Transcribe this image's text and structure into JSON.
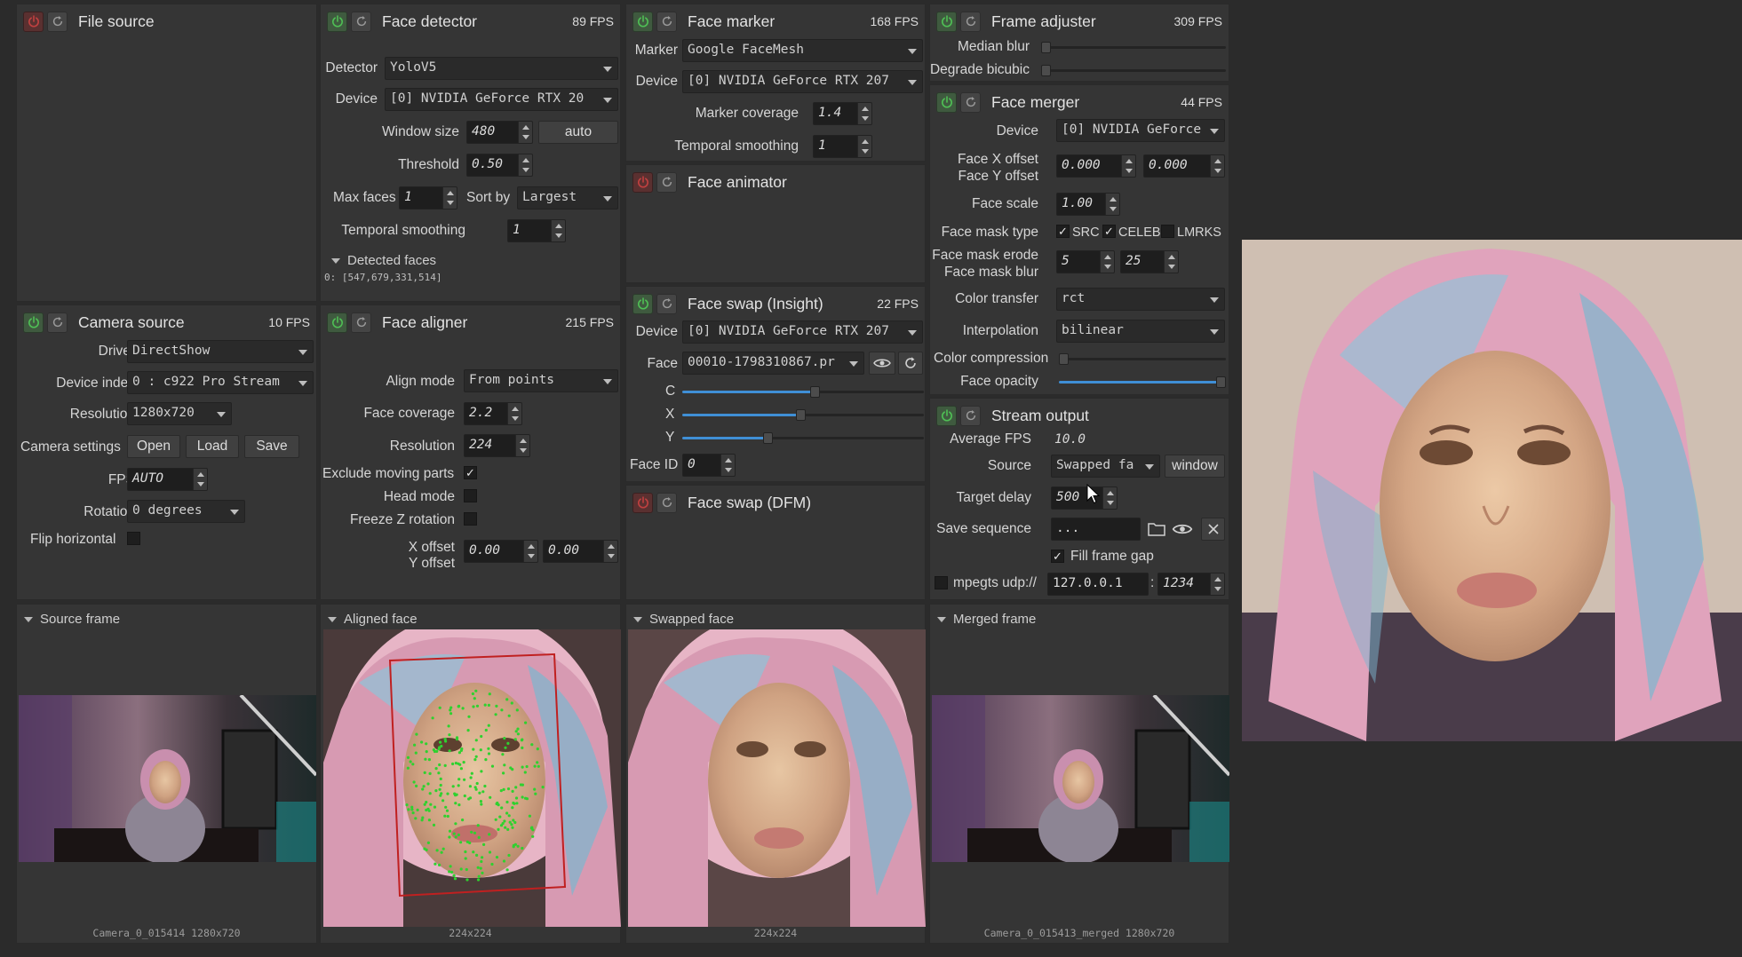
{
  "file_source": {
    "title": "File source"
  },
  "camera_source": {
    "title": "Camera source",
    "fps": "10 FPS",
    "driver_label": "Driver",
    "driver": "DirectShow",
    "device_index_label": "Device index",
    "device_index": "0 : c922 Pro Stream",
    "resolution_label": "Resolution",
    "resolution": "1280x720",
    "camera_settings_label": "Camera settings",
    "open": "Open",
    "load": "Load",
    "save": "Save",
    "fps_label": "FPS",
    "fps_value": "AUTO",
    "rotation_label": "Rotation",
    "rotation": "0 degrees",
    "flip_label": "Flip horizontal",
    "flip_checked": false
  },
  "face_detector": {
    "title": "Face detector",
    "fps": "89 FPS",
    "detector_label": "Detector",
    "detector": "YoloV5",
    "device_label": "Device",
    "device": "[0] NVIDIA GeForce RTX 20",
    "window_size_label": "Window size",
    "window_size": "480",
    "auto": "auto",
    "threshold_label": "Threshold",
    "threshold": "0.50",
    "max_faces_label": "Max faces",
    "max_faces": "1",
    "sort_by_label": "Sort by",
    "sort_by": "Largest",
    "temporal_label": "Temporal smoothing",
    "temporal": "1",
    "detected_label": "Detected faces",
    "detected_value": "0: [547,679,331,514]"
  },
  "face_aligner": {
    "title": "Face aligner",
    "fps": "215 FPS",
    "align_mode_label": "Align mode",
    "align_mode": "From points",
    "coverage_label": "Face coverage",
    "coverage": "2.2",
    "resolution_label": "Resolution",
    "resolution": "224",
    "exclude_label": "Exclude moving parts",
    "exclude_checked": true,
    "head_label": "Head mode",
    "freeze_label": "Freeze Z rotation",
    "x_offset_label": "X offset",
    "y_offset_label": "Y offset",
    "x_offset": "0.00",
    "y_offset": "0.00"
  },
  "face_marker": {
    "title": "Face marker",
    "fps": "168 FPS",
    "marker_label": "Marker",
    "marker": "Google FaceMesh",
    "device_label": "Device",
    "device": "[0] NVIDIA GeForce RTX 207",
    "coverage_label": "Marker coverage",
    "coverage": "1.4",
    "temporal_label": "Temporal smoothing",
    "temporal": "1"
  },
  "face_animator": {
    "title": "Face animator"
  },
  "face_swap_insight": {
    "title": "Face swap (Insight)",
    "fps": "22 FPS",
    "device_label": "Device",
    "device": "[0] NVIDIA GeForce RTX 207",
    "face_label": "Face",
    "face": "00010-1798310867.pr",
    "c_label": "C",
    "x_label": "X",
    "y_label": "Y",
    "c_value": 0.55,
    "x_value": 0.49,
    "y_value": 0.35,
    "face_id_label": "Face ID",
    "face_id": "0"
  },
  "face_swap_dfm": {
    "title": "Face swap (DFM)"
  },
  "frame_adjuster": {
    "title": "Frame adjuster",
    "fps": "309 FPS",
    "median_label": "Median blur",
    "degrade_label": "Degrade bicubic",
    "median_value": 0,
    "degrade_value": 0
  },
  "face_merger": {
    "title": "Face merger",
    "fps": "44 FPS",
    "device_label": "Device",
    "device": "[0] NVIDIA GeForce",
    "x_offset_label": "Face X offset",
    "y_offset_label": "Face Y offset",
    "x_offset": "0.000",
    "y_offset": "0.000",
    "scale_label": "Face scale",
    "scale": "1.00",
    "mask_type_label": "Face mask type",
    "src": "SRC",
    "celeb": "CELEB",
    "lmrks": "LMRKS",
    "erode_label": "Face mask erode",
    "blur_label": "Face mask blur",
    "erode": "5",
    "blur": "25",
    "color_transfer_label": "Color transfer",
    "color_transfer": "rct",
    "interpolation_label": "Interpolation",
    "interpolation": "bilinear",
    "color_compression_label": "Color compression",
    "color_compression_value": 0,
    "opacity_label": "Face opacity",
    "opacity_value": 1.0
  },
  "stream_output": {
    "title": "Stream output",
    "avg_fps_label": "Average FPS",
    "avg_fps": "10.0",
    "source_label": "Source",
    "source": "Swapped fa",
    "window": "window",
    "delay_label": "Target delay",
    "delay": "500",
    "save_seq_label": "Save sequence",
    "save_seq": "...",
    "fill_gap_label": "Fill frame gap",
    "mpegts_label": "mpegts udp://",
    "address": "127.0.0.1",
    "port": "1234"
  },
  "views": {
    "source_frame": "Source frame",
    "source_caption": "Camera_0_015414 1280x720",
    "aligned_face": "Aligned face",
    "aligned_caption": "224x224",
    "swapped_face": "Swapped face",
    "swapped_caption": "224x224",
    "merged_frame": "Merged frame",
    "merged_caption": "Camera_0_015413_merged 1280x720"
  },
  "colors": {
    "accent": "#3f8fd6",
    "panel": "#353535",
    "background": "#2b2b2b",
    "power_on": "#4fbf55",
    "power_off": "#c04040"
  }
}
